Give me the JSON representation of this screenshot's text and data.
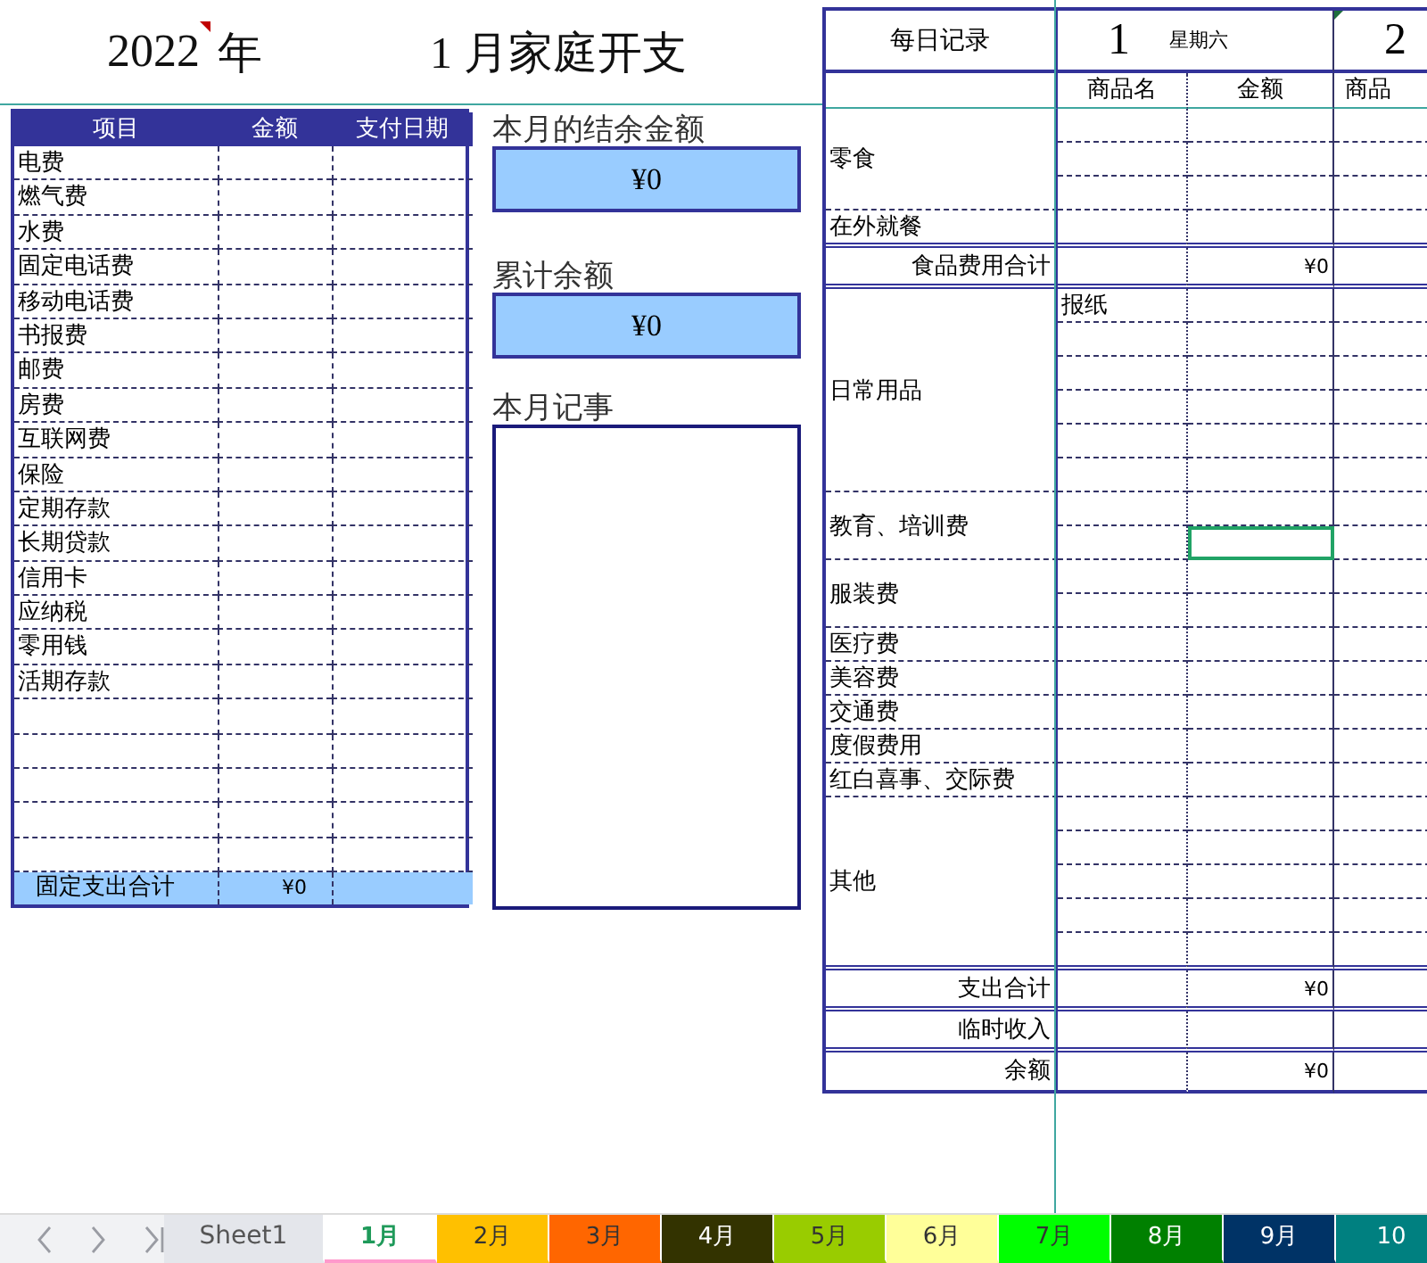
{
  "title": {
    "year": "2022",
    "year_has_comment": true,
    "year_unit": "年",
    "month_title": "1 月家庭开支"
  },
  "fixed_costs": {
    "columns": [
      "项目",
      "金额",
      "支付日期"
    ],
    "rows": [
      {
        "kind": "item",
        "label": "电费"
      },
      {
        "kind": "item",
        "label": "燃气费"
      },
      {
        "kind": "item",
        "label": "水费"
      },
      {
        "kind": "item",
        "label": "固定电话费"
      },
      {
        "kind": "item",
        "label": "移动电话费"
      },
      {
        "kind": "item",
        "label": "书报费"
      },
      {
        "kind": "item",
        "label": "邮费"
      },
      {
        "kind": "item",
        "label": "房费"
      },
      {
        "kind": "item",
        "label": "互联网费"
      },
      {
        "kind": "item",
        "label": "保险"
      },
      {
        "kind": "item",
        "label": "定期存款"
      },
      {
        "kind": "item",
        "label": "长期贷款"
      },
      {
        "kind": "item",
        "label": "信用卡"
      },
      {
        "kind": "item",
        "label": "应纳税"
      },
      {
        "kind": "item",
        "label": "零用钱"
      },
      {
        "kind": "item",
        "label": "活期存款"
      },
      {
        "kind": "blank"
      },
      {
        "kind": "blank"
      },
      {
        "kind": "blank"
      },
      {
        "kind": "blank"
      },
      {
        "kind": "blank"
      }
    ],
    "total": {
      "label": "固定支出合计",
      "amount": "¥0"
    }
  },
  "summary": [
    {
      "label": "本月的结余金额",
      "value": "¥0"
    },
    {
      "label": "累计余额",
      "value": "¥0"
    }
  ],
  "notes": {
    "label": "本月记事"
  },
  "daily": {
    "title": "每日记录",
    "days": [
      {
        "day": "1",
        "weekday": "星期六",
        "has_comment": false
      },
      {
        "day": "2",
        "has_comment": true
      }
    ],
    "columns": [
      "商品名",
      "金额",
      "商品"
    ],
    "sections": [
      {
        "kind": "category",
        "label": "零食",
        "lines": [
          {
            "selected": false
          },
          {
            "selected": false
          },
          {
            "selected": false
          }
        ]
      },
      {
        "kind": "category",
        "label": "在外就餐",
        "lines": [
          {
            "selected": false
          }
        ]
      },
      {
        "kind": "total",
        "label": "食品费用合计",
        "amount": "¥0"
      },
      {
        "kind": "category",
        "label": "日常用品",
        "lines": [
          {
            "selected": false,
            "item": "报纸"
          },
          {
            "selected": false
          },
          {
            "selected": false
          },
          {
            "selected": false
          },
          {
            "selected": false
          },
          {
            "selected": false
          }
        ]
      },
      {
        "kind": "category",
        "label": "教育、培训费",
        "lines": [
          {
            "selected": false
          },
          {
            "selected": true
          }
        ]
      },
      {
        "kind": "category",
        "label": "服装费",
        "lines": [
          {
            "selected": false
          },
          {
            "selected": false
          }
        ]
      },
      {
        "kind": "category",
        "label": "医疗费",
        "lines": [
          {
            "selected": false
          }
        ]
      },
      {
        "kind": "category",
        "label": "美容费",
        "lines": [
          {
            "selected": false
          }
        ]
      },
      {
        "kind": "category",
        "label": "交通费",
        "lines": [
          {
            "selected": false
          }
        ]
      },
      {
        "kind": "category",
        "label": "度假费用",
        "lines": [
          {
            "selected": false
          }
        ]
      },
      {
        "kind": "category",
        "label": "红白喜事、交际费",
        "lines": [
          {
            "selected": false
          }
        ]
      },
      {
        "kind": "category",
        "label": "其他",
        "lines": [
          {
            "selected": false
          },
          {
            "selected": false
          },
          {
            "selected": false
          },
          {
            "selected": false
          },
          {
            "selected": false
          }
        ]
      },
      {
        "kind": "total",
        "label": "支出合计",
        "amount": "¥0"
      },
      {
        "kind": "total",
        "label": "临时收入"
      },
      {
        "kind": "total",
        "label": "余额",
        "amount": "¥0"
      }
    ]
  },
  "sheet_tabs": [
    {
      "label": "Sheet1",
      "selected": false
    },
    {
      "label": "1月",
      "selected": true,
      "color": "#ff99cc"
    },
    {
      "label": "2月",
      "selected": false,
      "color": "#ffc000"
    },
    {
      "label": "3月",
      "selected": false,
      "color": "#ff6600"
    },
    {
      "label": "4月",
      "selected": false,
      "color": "#333300"
    },
    {
      "label": "5月",
      "selected": false,
      "color": "#99cc00"
    },
    {
      "label": "6月",
      "selected": false,
      "color": "#ffff99"
    },
    {
      "label": "7月",
      "selected": false,
      "color": "#00ff00"
    },
    {
      "label": "8月",
      "selected": false,
      "color": "#008000"
    },
    {
      "label": "9月",
      "selected": false,
      "color": "#003366"
    },
    {
      "label": "10",
      "selected": false,
      "color": "#008080"
    }
  ]
}
